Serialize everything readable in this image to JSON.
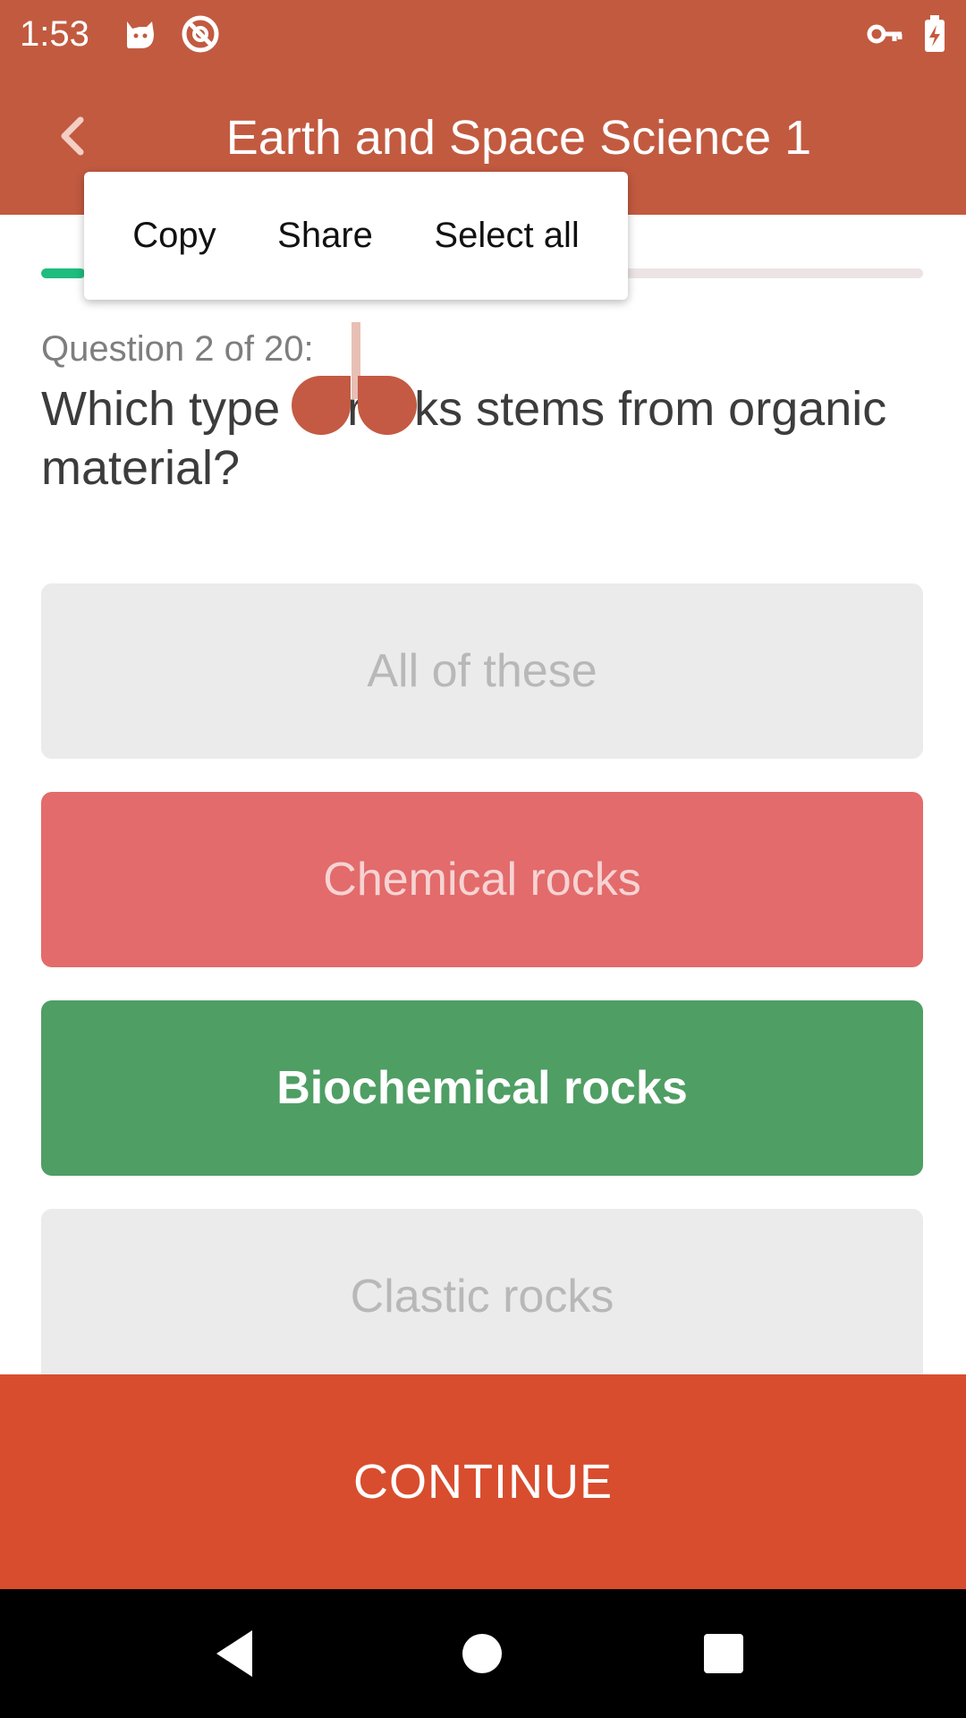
{
  "status_bar": {
    "time": "1:53"
  },
  "header": {
    "title": "Earth and Space Science 1"
  },
  "progress": {
    "value": 0.05
  },
  "context_menu": {
    "items": [
      "Copy",
      "Share",
      "Select all"
    ]
  },
  "question": {
    "number_label": "Question 2 of 20:",
    "text": "Which type of rocks stems from organic material?"
  },
  "answers": [
    {
      "label": "All of these",
      "state": "neutral"
    },
    {
      "label": "Chemical rocks",
      "state": "wrong"
    },
    {
      "label": "Biochemical rocks",
      "state": "correct"
    },
    {
      "label": "Clastic rocks",
      "state": "neutral"
    }
  ],
  "continue_button": {
    "label": "CONTINUE"
  },
  "colors": {
    "header": "#c25a40",
    "progress": "#1ebc7d",
    "wrong": "#e36b6b",
    "correct": "#4f9e64",
    "continue": "#d84d2e"
  },
  "icons": {
    "status": [
      "cat-notification-icon",
      "no-data-icon",
      "vpn-key-icon",
      "battery-charging-icon"
    ],
    "nav": [
      "back-triangle-icon",
      "home-circle-icon",
      "recents-square-icon"
    ]
  }
}
